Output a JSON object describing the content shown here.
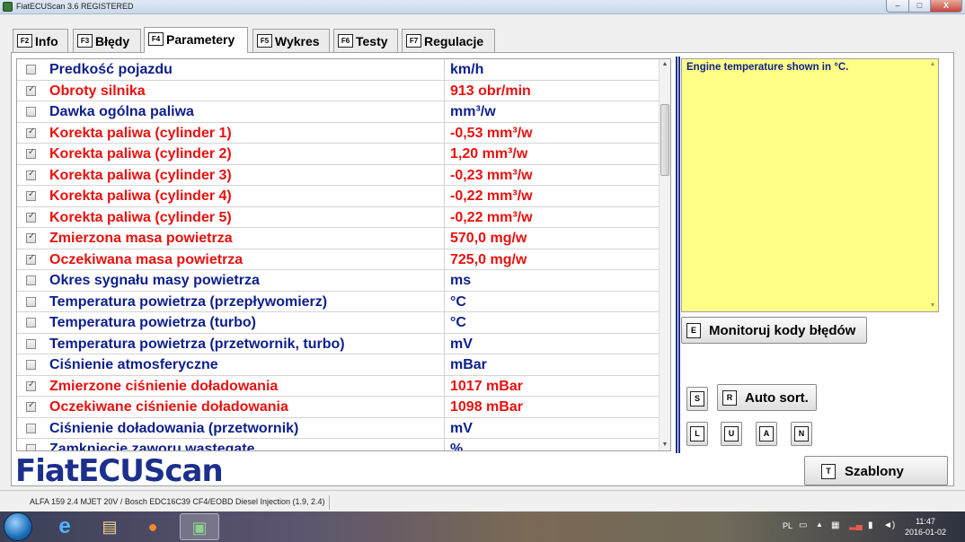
{
  "window": {
    "title": "FiatECUScan 3.6 REGISTERED"
  },
  "window_controls": {
    "minimize": "–",
    "maximize": "□",
    "close": "X"
  },
  "tabs": [
    {
      "key": "F2",
      "label": "Info",
      "active": false
    },
    {
      "key": "F3",
      "label": "Błędy",
      "active": false
    },
    {
      "key": "F4",
      "label": "Parametery",
      "active": true
    },
    {
      "key": "F5",
      "label": "Wykres",
      "active": false
    },
    {
      "key": "F6",
      "label": "Testy",
      "active": false
    },
    {
      "key": "F7",
      "label": "Regulacje",
      "active": false
    }
  ],
  "parameters": [
    {
      "name": "Predkość pojazdu",
      "value": "km/h",
      "checked": false
    },
    {
      "name": "Obroty silnika",
      "value": "913 obr/min",
      "checked": true
    },
    {
      "name": "Dawka ogólna paliwa",
      "value": "mm³/w",
      "checked": false
    },
    {
      "name": "Korekta paliwa (cylinder 1)",
      "value": "-0,53 mm³/w",
      "checked": true
    },
    {
      "name": "Korekta paliwa (cylinder 2)",
      "value": "1,20 mm³/w",
      "checked": true
    },
    {
      "name": "Korekta paliwa (cylinder 3)",
      "value": "-0,23 mm³/w",
      "checked": true
    },
    {
      "name": "Korekta paliwa (cylinder 4)",
      "value": "-0,22 mm³/w",
      "checked": true
    },
    {
      "name": "Korekta paliwa (cylinder 5)",
      "value": "-0,22 mm³/w",
      "checked": true
    },
    {
      "name": "Zmierzona masa powietrza",
      "value": "570,0 mg/w",
      "checked": true
    },
    {
      "name": "Oczekiwana masa powietrza",
      "value": "725,0 mg/w",
      "checked": true
    },
    {
      "name": "Okres sygnału masy powietrza",
      "value": "ms",
      "checked": false
    },
    {
      "name": "Temperatura powietrza (przepływomierz)",
      "value": "°C",
      "checked": false
    },
    {
      "name": "Temperatura powietrza (turbo)",
      "value": "°C",
      "checked": false
    },
    {
      "name": "Temperatura powietrza (przetwornik, turbo)",
      "value": "mV",
      "checked": false
    },
    {
      "name": "Ciśnienie atmosferyczne",
      "value": "mBar",
      "checked": false
    },
    {
      "name": "Zmierzone ciśnienie doładowania",
      "value": "1017 mBar",
      "checked": true
    },
    {
      "name": "Oczekiwane ciśnienie doładowania",
      "value": "1098 mBar",
      "checked": true
    },
    {
      "name": "Ciśnienie doładowania (przetwornik)",
      "value": "mV",
      "checked": false
    },
    {
      "name": "Zamknięcie zaworu wastegate",
      "value": "%",
      "checked": false
    }
  ],
  "description": {
    "text": "Engine temperature shown in °C."
  },
  "buttons": {
    "monitor": {
      "key": "E",
      "label": "Monitoruj kody błędów"
    },
    "s": {
      "key": "S"
    },
    "autosort": {
      "key": "R",
      "label": "Auto sort."
    },
    "l": {
      "key": "L"
    },
    "u": {
      "key": "U"
    },
    "a": {
      "key": "A"
    },
    "n": {
      "key": "N"
    },
    "templates": {
      "key": "T",
      "label": "Szablony"
    }
  },
  "logo": {
    "text": "FiatECUScan"
  },
  "status": {
    "vehicle": "ALFA 159 2.4 MJET 20V / Bosch EDC16C39 CF4/EOBD Diesel Injection (1.9, 2.4)"
  },
  "taskbar": {
    "lang": "PL",
    "time": "11:47",
    "date": "2016-01-02"
  },
  "colors": {
    "active_param": "#e8110f",
    "inactive_param": "#0d1f8c",
    "description_bg": "#ffff88",
    "logo": "#1c2f8c"
  }
}
